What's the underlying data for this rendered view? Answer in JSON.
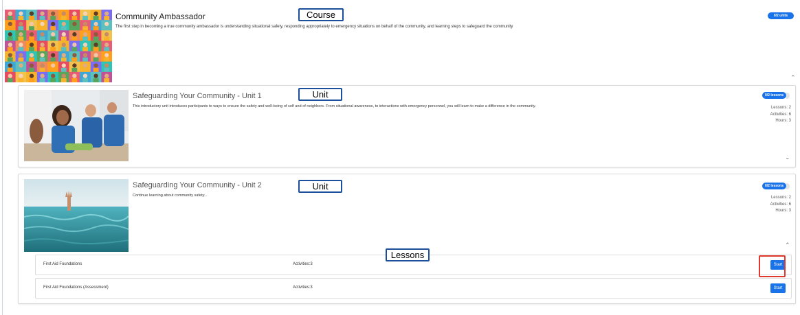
{
  "course": {
    "title": "Community Ambassador",
    "description": "The first step in becoming a true community ambassador is understanding situational safety, responding appropriately to emergency situations on behalf of the community, and learning steps to safeguard the community",
    "badge": "0/2 units",
    "tag": "Course"
  },
  "units": [
    {
      "title": "Safeguarding Your Community - Unit 1",
      "description": "This introductory unit introduces participants to ways to ensure the safety and well-being of self and of neighbors. From situational awareness, to interactions with emergency personnel, you will learn to make a difference in the community.",
      "badge": "0/2 lessons",
      "lessons_stat": "Lessons: 2",
      "activities_stat": "Activities: 6",
      "hours_stat": "Hours: 3",
      "tag": "Unit"
    },
    {
      "title": "Safeguarding Your Community - Unit 2",
      "description": "Continue learning about community safety...",
      "badge": "0/2 lessons",
      "lessons_stat": "Lessons: 2",
      "activities_stat": "Activities: 6",
      "hours_stat": "Hours: 3",
      "tag": "Unit"
    }
  ],
  "lessons_tag": "Lessons",
  "lessons": [
    {
      "name": "First Aid Foundations",
      "activities": "Activities:3",
      "button": "Start"
    },
    {
      "name": "First Aid Foundations (Assessment)",
      "activities": "Activities:3",
      "button": "Start"
    }
  ],
  "icons": {
    "expand": "chevron-up-icon",
    "collapse": "chevron-down-icon"
  },
  "colors": {
    "accent": "#1a73e8",
    "highlight": "#e0382d",
    "tag_border": "#1b4f9c"
  }
}
